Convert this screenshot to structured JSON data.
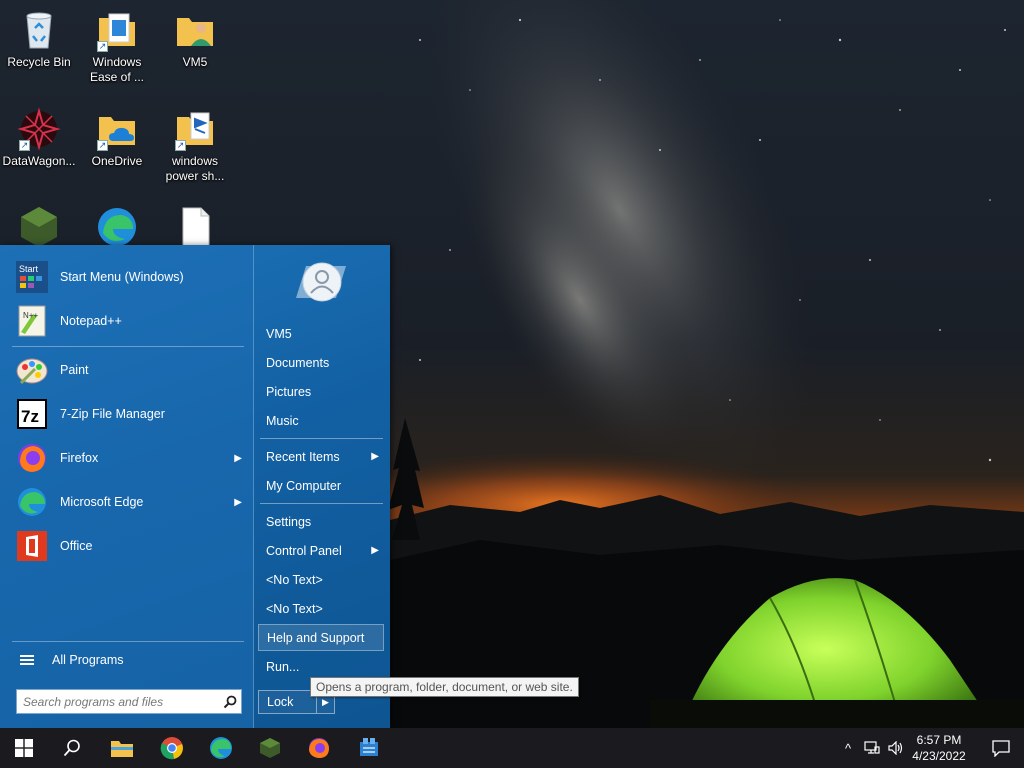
{
  "desktop": {
    "icons": [
      {
        "label": "Recycle Bin",
        "icon": "recycle-bin-icon"
      },
      {
        "label": "Windows Ease of ...",
        "icon": "folder-shortcut-icon"
      },
      {
        "label": "VM5",
        "icon": "user-folder-icon"
      },
      {
        "label": "DataWagon...",
        "icon": "datawagon-icon"
      },
      {
        "label": "OneDrive",
        "icon": "onedrive-folder-icon"
      },
      {
        "label": "windows power sh...",
        "icon": "powershell-folder-icon"
      },
      {
        "label": "",
        "icon": "minecraft-icon"
      },
      {
        "label": "",
        "icon": "edge-icon"
      },
      {
        "label": "",
        "icon": "blank-file-icon"
      }
    ]
  },
  "start_menu": {
    "programs": [
      {
        "label": "Start Menu (Windows)",
        "icon": "start-menu-app-icon",
        "has_submenu": false
      },
      {
        "label": "Notepad++",
        "icon": "notepadpp-icon",
        "has_submenu": false
      },
      {
        "label": "Paint",
        "icon": "paint-icon",
        "has_submenu": false
      },
      {
        "label": "7-Zip File Manager",
        "icon": "sevenzip-icon",
        "has_submenu": false
      },
      {
        "label": "Firefox",
        "icon": "firefox-icon",
        "has_submenu": true
      },
      {
        "label": "Microsoft Edge",
        "icon": "edge-icon",
        "has_submenu": true
      },
      {
        "label": "Office",
        "icon": "office-icon",
        "has_submenu": false
      }
    ],
    "start_icon_text": "Start",
    "notepad_icon_text": "N++",
    "sevenzip_icon_text": "7z",
    "all_programs_label": "All Programs",
    "search_placeholder": "Search programs and files",
    "right_items": [
      {
        "label": "VM5",
        "has_submenu": false
      },
      {
        "label": "Documents",
        "has_submenu": false
      },
      {
        "label": "Pictures",
        "has_submenu": false
      },
      {
        "label": "Music",
        "has_submenu": false
      },
      {
        "label": "Recent Items",
        "has_submenu": true
      },
      {
        "label": "My Computer",
        "has_submenu": false
      },
      {
        "label": "Settings",
        "has_submenu": false
      },
      {
        "label": "Control Panel",
        "has_submenu": true
      },
      {
        "label": "<No Text>",
        "has_submenu": false
      },
      {
        "label": "<No Text>",
        "has_submenu": false
      },
      {
        "label": "Help and Support",
        "has_submenu": false,
        "highlighted": true
      },
      {
        "label": "Run...",
        "has_submenu": false
      }
    ],
    "lock_label": "Lock",
    "arrow_glyph": "▶",
    "tooltip": "Opens a program, folder, document, or web site."
  },
  "taskbar": {
    "pinned": [
      "windows-start-icon",
      "search-icon",
      "file-explorer-icon",
      "chrome-icon",
      "edge-icon",
      "minecraft-icon",
      "firefox-icon",
      "datawagon-icon"
    ],
    "tray": {
      "chevron": "^",
      "network": "network-icon",
      "volume": "volume-icon"
    },
    "time": "6:57 PM",
    "date": "4/23/2022"
  },
  "colors": {
    "start_menu_bg": "#1565a8",
    "taskbar_bg": "#1a1a1f",
    "tent_green": "#8fe03a",
    "sky_glow": "#d8661e"
  }
}
